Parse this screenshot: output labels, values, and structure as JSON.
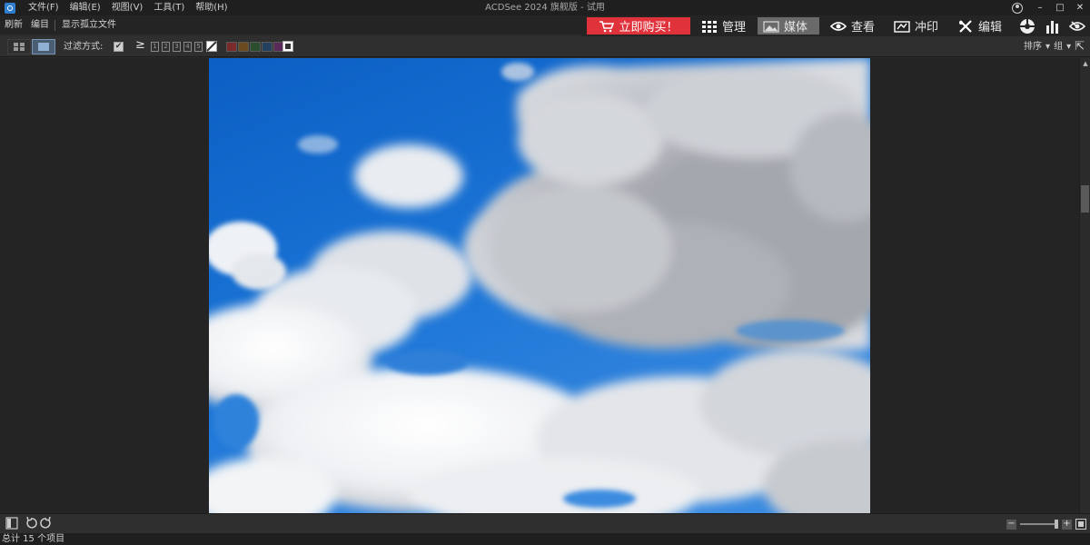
{
  "titlebar": {
    "title": "ACDSee 2024 旗舰版 - 试用",
    "menu": [
      "文件(F)",
      "编辑(E)",
      "视图(V)",
      "工具(T)",
      "帮助(H)"
    ],
    "controls": {
      "minimize": "–",
      "maximize": "□",
      "close": "✕"
    }
  },
  "cmdbar": {
    "refresh": "刷新",
    "catalog": "编目",
    "show_orphans": "显示孤立文件"
  },
  "modebar": {
    "buy": "立即购买！",
    "modes": [
      {
        "label": "管理"
      },
      {
        "label": "媒体"
      },
      {
        "label": "查看"
      },
      {
        "label": "冲印"
      },
      {
        "label": "编辑"
      }
    ],
    "active_mode": "媒体"
  },
  "filterbar": {
    "filter_label": "过滤方式:",
    "ge_symbol": "≥",
    "ratings": [
      "1",
      "2",
      "3",
      "4",
      "5"
    ],
    "color_labels": [
      "#7a2a2a",
      "#6a4a1e",
      "#2a4e2e",
      "#23405e",
      "#5a2a5a"
    ],
    "sort_label": "排序",
    "group_label": "组"
  },
  "status": {
    "text": "总计 15 个项目"
  },
  "colors": {
    "accent": "#e0323b",
    "active_mode_bg": "#6a6a6a",
    "sky": "#1f6fcf"
  }
}
